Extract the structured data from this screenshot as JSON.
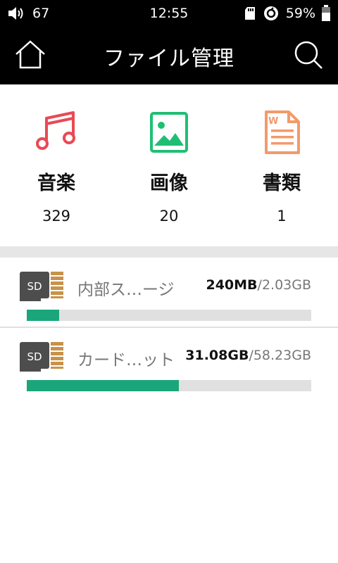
{
  "status_bar": {
    "volume": "67",
    "time": "12:55",
    "battery": "59%"
  },
  "app_bar": {
    "title": "ファイル管理"
  },
  "categories": [
    {
      "label": "音楽",
      "count": "329",
      "icon": "music-note-icon",
      "color": "#e84a55"
    },
    {
      "label": "画像",
      "count": "20",
      "icon": "image-icon",
      "color": "#1fbf73"
    },
    {
      "label": "書類",
      "count": "1",
      "icon": "document-icon",
      "color": "#f29a6b"
    }
  ],
  "storage": [
    {
      "icon_text": "SD",
      "name": "内部ス…ージ",
      "used": "240MB",
      "separator": "/",
      "total": "2.03GB",
      "used_fraction": 0.115
    },
    {
      "icon_text": "SD",
      "name": "カード…ット",
      "used": "31.08GB",
      "separator": "/",
      "total": "58.23GB",
      "used_fraction": 0.534
    }
  ],
  "colors": {
    "accent": "#1aa67a",
    "bar_track": "#e0e0e0",
    "header_bg": "#000000"
  }
}
